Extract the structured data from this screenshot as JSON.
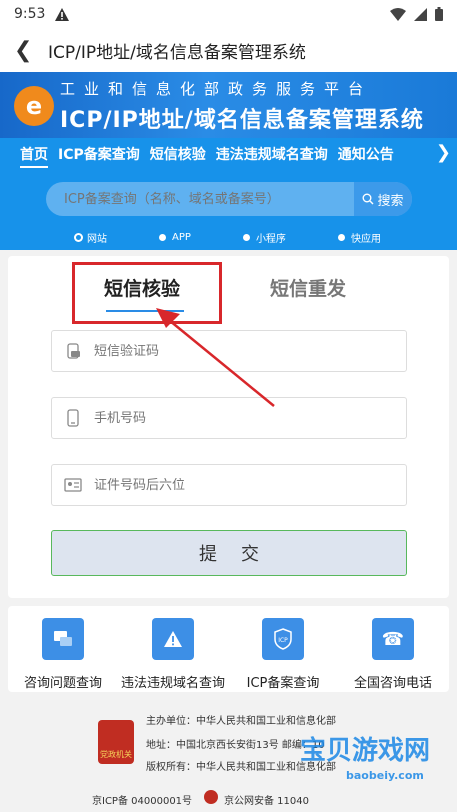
{
  "status": {
    "time": "9:53"
  },
  "appbar": {
    "title": "ICP/IP地址/域名信息备案管理系统"
  },
  "banner": {
    "line1": "工业和信息化部政务服务平台",
    "line2": "ICP/IP地址/域名信息备案管理系统"
  },
  "nav": {
    "tabs": [
      "首页",
      "ICP备案查询",
      "短信核验",
      "违法违规域名查询",
      "通知公告"
    ],
    "search_placeholder": "ICP备案查询（名称、域名或备案号）",
    "search_button": "搜索",
    "types": [
      "网站",
      "APP",
      "小程序",
      "快应用"
    ]
  },
  "form": {
    "tab_active": "短信核验",
    "tab_other": "短信重发",
    "sms_code_placeholder": "短信验证码",
    "phone_placeholder": "手机号码",
    "id_placeholder": "证件号码后六位",
    "submit": "提交"
  },
  "quick": [
    {
      "label": "咨询问题查询",
      "icon": "chat-icon"
    },
    {
      "label": "违法违规域名查询",
      "icon": "warning-icon"
    },
    {
      "label": "ICP备案查询",
      "icon": "shield-icon"
    },
    {
      "label": "全国咨询电话",
      "icon": "phone-icon"
    }
  ],
  "footer": {
    "sponsor": "主办单位：中华人民共和国工业和信息化部",
    "address": "地址：中国北京西长安街13号 邮编：10",
    "copyright": "版权所有：中华人民共和国工业和信息化部",
    "icp": "京ICP备 04000001号",
    "police": "京公网安备 11040",
    "emblem_text": "党政机关"
  },
  "watermark": {
    "main": "宝贝游戏网",
    "sub": "baobeiy.com"
  },
  "colors": {
    "nav": "#1792ea",
    "banner": "#1768c9",
    "highlight": "#d8272b",
    "submit_border": "#58b85c"
  }
}
